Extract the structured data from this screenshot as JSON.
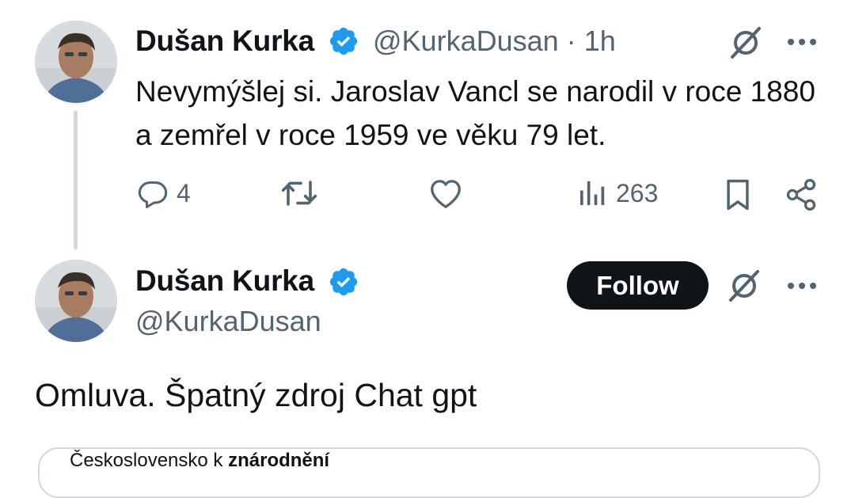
{
  "colors": {
    "verified": "#1d9bf0",
    "text_primary": "#0f1419",
    "text_secondary": "#536471",
    "follow_bg": "#0f1419",
    "thread_line": "#cfd9de"
  },
  "reply_tweet": {
    "author_name": "Dušan Kurka",
    "handle": "@KurkaDusan",
    "separator": "·",
    "time": "1h",
    "text": "Nevymýšlej si. Jaroslav Vancl se narodil v roce 1880 a zemřel v roce 1959 ve věku 79 let.",
    "actions": {
      "reply_count": "4",
      "retweet_count": "",
      "like_count": "",
      "views_count": "263"
    },
    "icons": [
      "avatar",
      "verified-badge-icon",
      "grok-icon",
      "more-icon",
      "reply-icon",
      "retweet-icon",
      "like-icon",
      "views-icon",
      "bookmark-icon",
      "share-icon"
    ]
  },
  "main_tweet": {
    "author_name": "Dušan Kurka",
    "handle": "@KurkaDusan",
    "follow_label": "Follow",
    "text": "Omluva. Špatný zdroj Chat gpt",
    "quoted_preview_text": "Československo k ",
    "quoted_preview_bold": "znárodnění"
  }
}
